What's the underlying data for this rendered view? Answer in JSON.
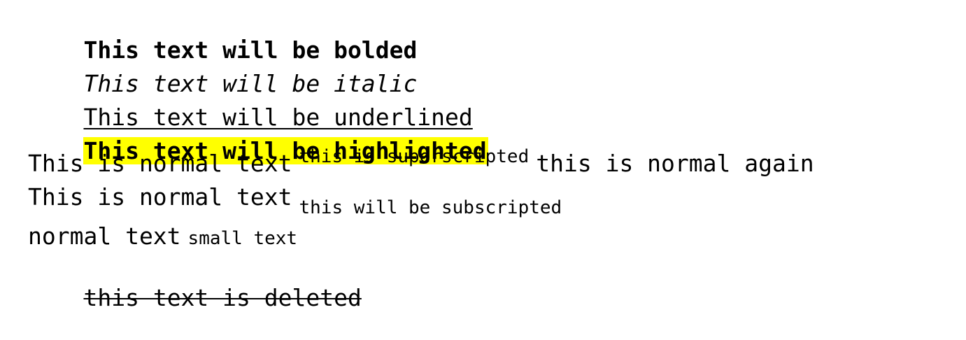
{
  "lines": {
    "bold": "This text will be bolded",
    "italic": "This text will be italic",
    "underlined": "This text will be underlined",
    "highlighted": "This text will be highlighted",
    "superscript_line": {
      "normal_before": "This is normal text",
      "superscript": "this is superscripted",
      "normal_after": "this is normal again"
    },
    "subscript_line": {
      "normal_before": "This is normal text",
      "subscript": "this will be subscripted"
    },
    "small_line": {
      "normal": "normal text",
      "small": "small text"
    },
    "deleted": "this text is deleted"
  },
  "colors": {
    "highlight": "#ffff00",
    "text": "#000000",
    "background": "#ffffff"
  }
}
